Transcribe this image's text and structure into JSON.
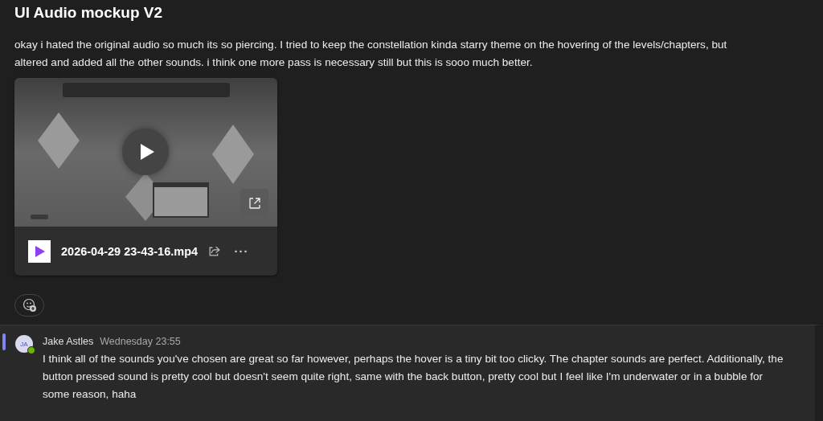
{
  "post": {
    "title": "UI Audio mockup V2",
    "text": "okay i hated the original audio so much its so piercing. I tried to keep the constellation kinda starry theme on the hovering of the levels/chapters, but altered and added all the other sounds. i think one more pass is necessary still but this is sooo much better.",
    "attachment": {
      "file_name": "2026-04-29 23-43-16.mp4"
    }
  },
  "reply": {
    "initials": "JA",
    "online": true,
    "author": "Jake Astles",
    "time": "Wednesday 23:55",
    "text": "I think all of the sounds you've chosen are great so far however, perhaps the hover is a tiny bit too clicky. The chapter sounds are perfect. Additionally, the button pressed sound is pretty cool but doesn't seem quite right, same with the back button, pretty cool but I feel like I'm underwater or in a bubble for some reason, haha"
  }
}
